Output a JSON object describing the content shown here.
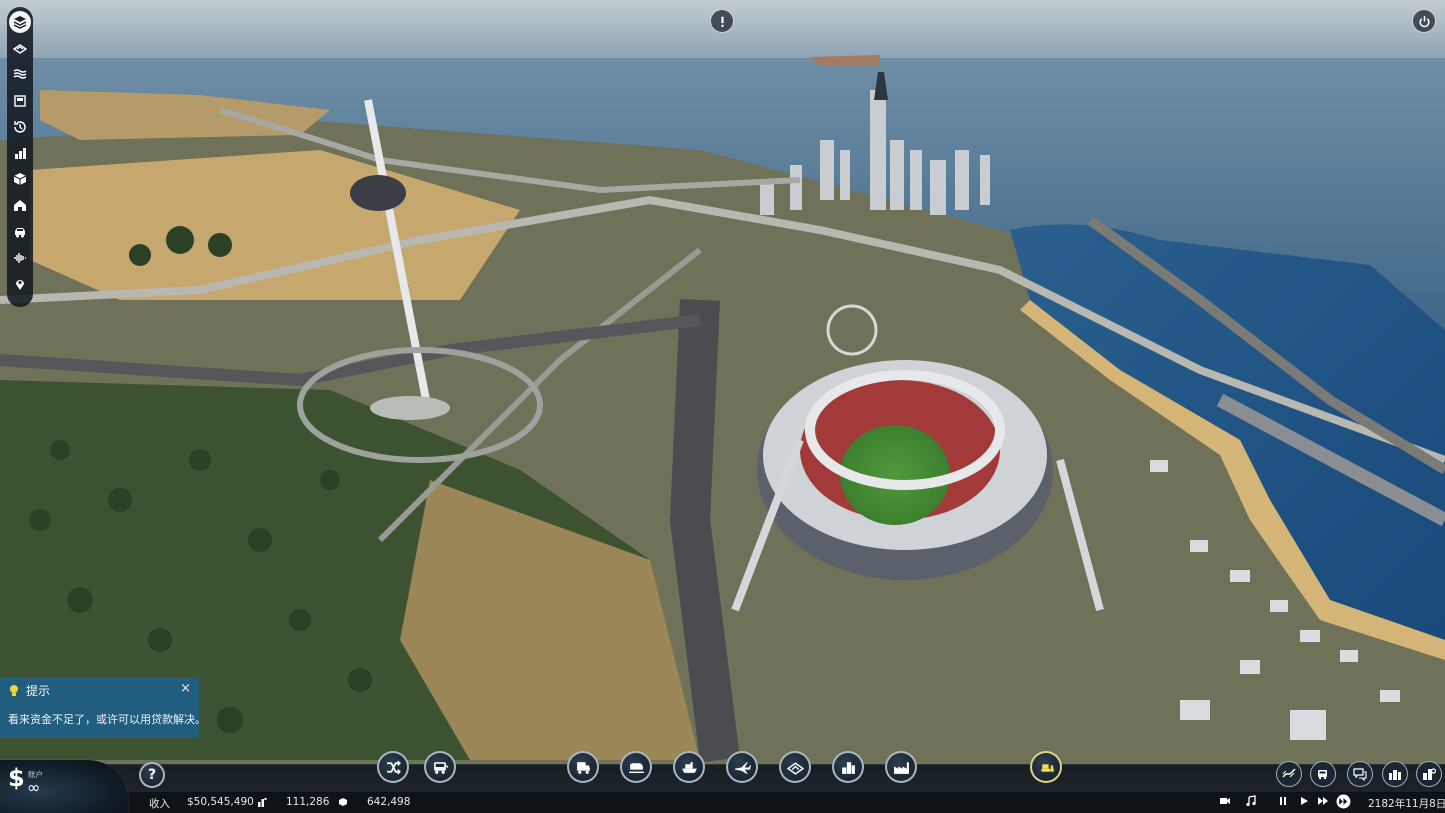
{
  "tip": {
    "title": "提示",
    "close": "×",
    "message": "看来资金不足了，或许可以用贷款解决。"
  },
  "account": {
    "currency_symbol": "$",
    "label": "账户",
    "value": "∞"
  },
  "help": {
    "label": "?"
  },
  "status": {
    "income_label": "收入",
    "income_value": "$50,545,490",
    "population_value": "111,286",
    "cargo_value": "642,498",
    "date": "2182年11月8日"
  },
  "left_toolbar": [
    "layers-icon",
    "terrain-icon",
    "water-icon",
    "map-icon",
    "history-icon",
    "statistics-icon",
    "cargo-box-icon",
    "company-icon",
    "vehicles-icon",
    "audio-wave-icon",
    "location-icon"
  ],
  "bottom_tools": [
    "shuffle-lines-icon",
    "bus-icon",
    "truck-icon",
    "train-icon",
    "ship-icon",
    "airplane-icon",
    "terrain-edit-icon",
    "town-icon",
    "industry-icon",
    "bulldozer-icon"
  ],
  "right_tools": [
    "track-icon",
    "vehicle-list-icon",
    "chat-icon",
    "city-stats-icon",
    "settings-cities-icon"
  ],
  "colors": {
    "tip_bg": "#1c608c",
    "toolbar_bg": "#0e161e",
    "status_bg": "#0a1016"
  }
}
